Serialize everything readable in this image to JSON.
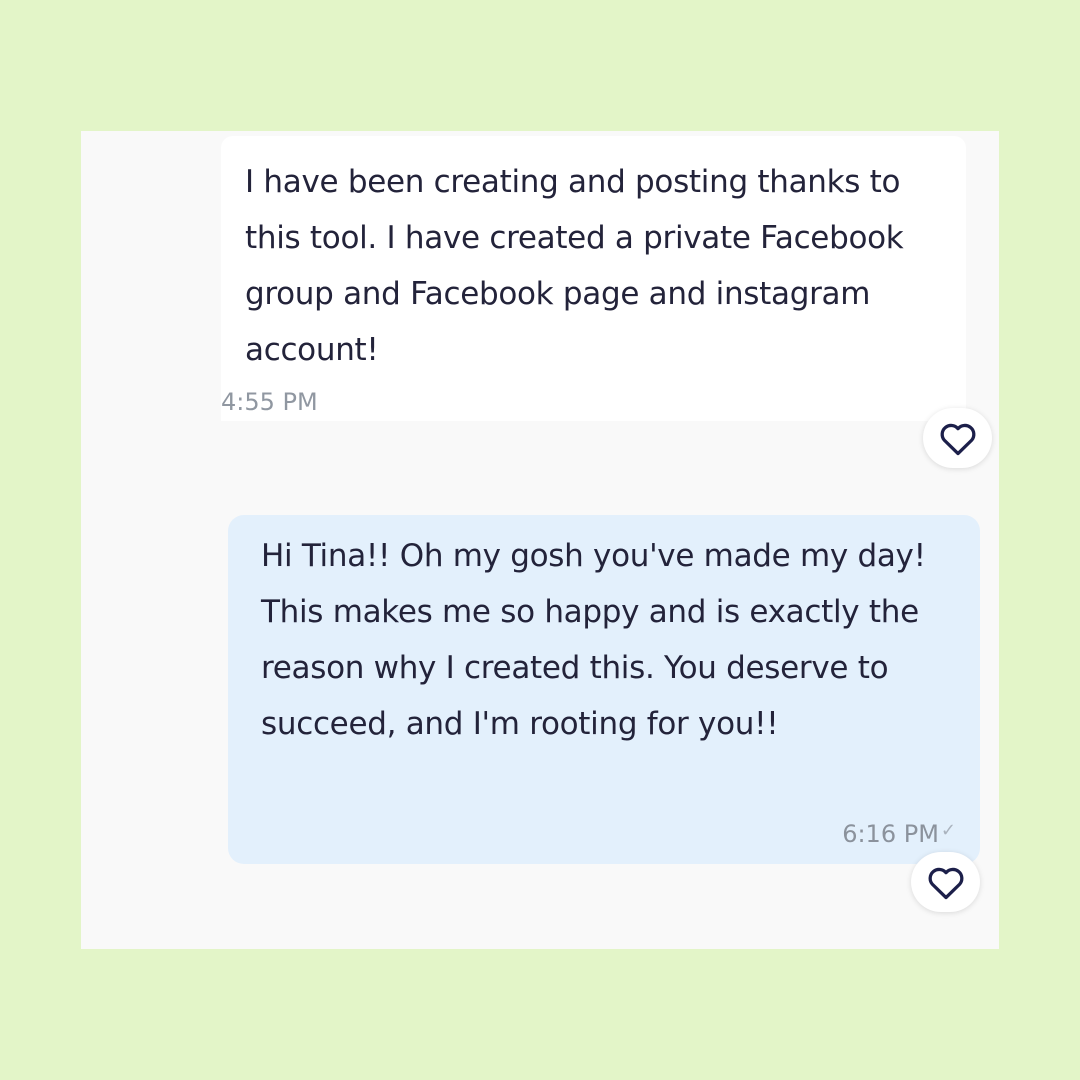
{
  "messages": [
    {
      "direction": "incoming",
      "text": "I have been creating and posting thanks to this tool. I have created a private Facebook group and Facebook page and instagram account!",
      "time": "4:55 PM",
      "reaction_icon": "heart-outline-icon"
    },
    {
      "direction": "outgoing",
      "text": "Hi Tina!! Oh my gosh you've made my day! This makes me so happy and is exactly the reason why I created this. You deserve to succeed, and I'm rooting for you!!",
      "time": "6:16 PM",
      "status_icon": "checkmark-icon",
      "status_glyph": "✓",
      "reaction_icon": "heart-outline-icon"
    }
  ],
  "colors": {
    "page_background": "#e3f5c8",
    "panel_background": "#f9f9f9",
    "incoming_bubble": "#ffffff",
    "outgoing_bubble": "#e3f0fc",
    "message_text": "#23233a",
    "timestamp": "#9097a1",
    "heart_stroke": "#1c1f4a"
  }
}
